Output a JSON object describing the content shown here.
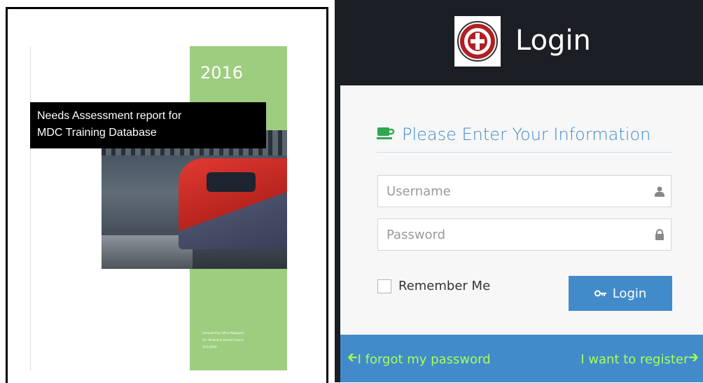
{
  "document": {
    "year": "2016",
    "title_line1": "Needs Assessment report for",
    "title_line2": "MDC Training Database",
    "footer_line1": "Compiled by: Sifiso Magagula",
    "footer_line2": "For: Medical & Dental Council",
    "footer_line3": "1/11/2016"
  },
  "login": {
    "heading": "Login",
    "form_heading": "Please Enter Your Information",
    "username_placeholder": "Username",
    "password_placeholder": "Password",
    "remember_label": "Remember Me",
    "login_button": "Login",
    "forgot_link": "I forgot my password",
    "register_link": "I want to register",
    "icons": {
      "heading": "coffee-icon",
      "username": "user-icon",
      "password": "lock-icon",
      "button": "key-icon",
      "forgot": "arrow-left-icon",
      "register": "arrow-right-icon"
    }
  },
  "colors": {
    "accent_blue": "#428bca",
    "link_green": "#a8ff54",
    "coffee_green": "#2fa84f",
    "doc_green": "#9dcd7f",
    "header_dark": "#1b1e24"
  }
}
